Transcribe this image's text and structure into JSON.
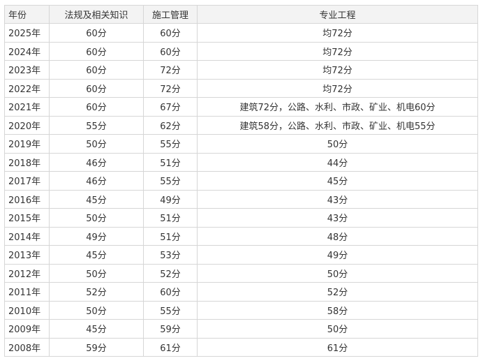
{
  "table": {
    "headers": [
      "年份",
      "法规及相关知识",
      "施工管理",
      "专业工程"
    ],
    "rows": [
      [
        "2025年",
        "60分",
        "60分",
        "均72分"
      ],
      [
        "2024年",
        "60分",
        "60分",
        "均72分"
      ],
      [
        "2023年",
        "60分",
        "72分",
        "均72分"
      ],
      [
        "2022年",
        "60分",
        "72分",
        "均72分"
      ],
      [
        "2021年",
        "60分",
        "67分",
        "建筑72分，公路、水利、市政、矿业、机电60分"
      ],
      [
        "2020年",
        "55分",
        "62分",
        "建筑58分，公路、水利、市政、矿业、机电55分"
      ],
      [
        "2019年",
        "50分",
        "55分",
        "50分"
      ],
      [
        "2018年",
        "46分",
        "51分",
        "44分"
      ],
      [
        "2017年",
        "46分",
        "55分",
        "45分"
      ],
      [
        "2016年",
        "45分",
        "49分",
        "43分"
      ],
      [
        "2015年",
        "50分",
        "51分",
        "43分"
      ],
      [
        "2014年",
        "49分",
        "51分",
        "48分"
      ],
      [
        "2013年",
        "45分",
        "53分",
        "49分"
      ],
      [
        "2012年",
        "50分",
        "52分",
        "50分"
      ],
      [
        "2011年",
        "52分",
        "60分",
        "52分"
      ],
      [
        "2010年",
        "50分",
        "55分",
        "58分"
      ],
      [
        "2009年",
        "45分",
        "59分",
        "50分"
      ],
      [
        "2008年",
        "59分",
        "61分",
        "61分"
      ]
    ]
  }
}
